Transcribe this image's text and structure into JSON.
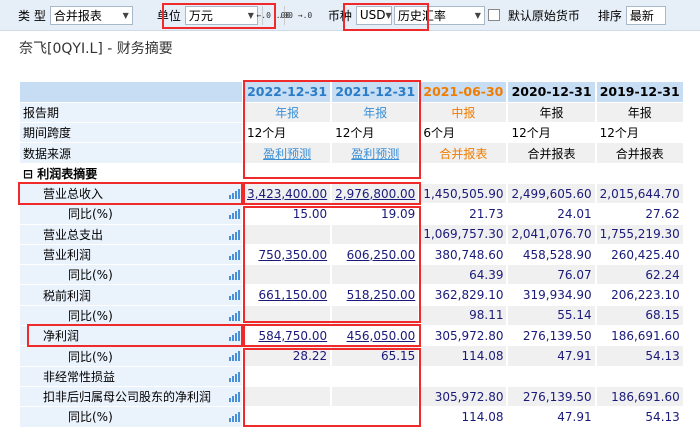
{
  "toolbar": {
    "type_label": "类 型",
    "type_value": "合并报表",
    "unit_label": "单位",
    "unit_value": "万元",
    "currency_label": "币种",
    "currency_value": "USD",
    "rate_value": "历史汇率",
    "default_currency_label": "默认原始货币",
    "sort_label": "排序",
    "sort_value": "最新",
    "dec_icon1": "←.0 .00",
    "dec_icon2": ".00 →.0"
  },
  "title": "奈飞[0QYI.L] - 财务摘要",
  "colors": {
    "header_bg": "#c7ddf4",
    "label_bg": "#eaf2fc",
    "highlight": "#f02a2a",
    "interim": "#f07c00",
    "forecast": "#3a8fd6"
  },
  "columns": [
    {
      "date": "2022-12-31",
      "period": "年报",
      "span": "12个月",
      "source": "盈利预测",
      "style": "forecast"
    },
    {
      "date": "2021-12-31",
      "period": "年报",
      "span": "12个月",
      "source": "盈利预测",
      "style": "forecast"
    },
    {
      "date": "2021-06-30",
      "period": "中报",
      "span": "6个月",
      "source": "合并报表",
      "style": "interim"
    },
    {
      "date": "2020-12-31",
      "period": "年报",
      "span": "12个月",
      "source": "合并报表",
      "style": "normal"
    },
    {
      "date": "2019-12-31",
      "period": "年报",
      "span": "12个月",
      "source": "合并报表",
      "style": "normal"
    }
  ],
  "meta_labels": {
    "period": "报告期",
    "span": "期间跨度",
    "source": "数据来源"
  },
  "section": {
    "toggle": "⊟",
    "label": "利润表摘要"
  },
  "rows": [
    {
      "label": "营业总收入",
      "indent": 1,
      "link": true,
      "values": [
        "3,423,400.00",
        "2,976,800.00",
        "1,450,505.90",
        "2,499,605.60",
        "2,015,644.70"
      ]
    },
    {
      "label": "同比(%)",
      "indent": 2,
      "values": [
        "15.00",
        "19.09",
        "21.73",
        "24.01",
        "27.62"
      ]
    },
    {
      "label": "营业总支出",
      "indent": 1,
      "values": [
        "",
        "",
        "1,069,757.30",
        "2,041,076.70",
        "1,755,219.30"
      ]
    },
    {
      "label": "营业利润",
      "indent": 1,
      "link": true,
      "values": [
        "750,350.00",
        "606,250.00",
        "380,748.60",
        "458,528.90",
        "260,425.40"
      ]
    },
    {
      "label": "同比(%)",
      "indent": 2,
      "values": [
        "",
        "",
        "64.39",
        "76.07",
        "62.24"
      ]
    },
    {
      "label": "税前利润",
      "indent": 1,
      "link": true,
      "values": [
        "661,150.00",
        "518,250.00",
        "362,829.10",
        "319,934.90",
        "206,223.10"
      ]
    },
    {
      "label": "同比(%)",
      "indent": 2,
      "values": [
        "",
        "",
        "98.11",
        "55.14",
        "68.15"
      ]
    },
    {
      "label": "净利润",
      "indent": 1,
      "link": true,
      "values": [
        "584,750.00",
        "456,050.00",
        "305,972.80",
        "276,139.50",
        "186,691.60"
      ]
    },
    {
      "label": "同比(%)",
      "indent": 2,
      "values": [
        "28.22",
        "65.15",
        "114.08",
        "47.91",
        "54.13"
      ]
    },
    {
      "label": "非经常性损益",
      "indent": 1,
      "values": [
        "",
        "",
        "",
        "",
        ""
      ]
    },
    {
      "label": "扣非后归属母公司股东的净利润",
      "indent": 1,
      "values": [
        "",
        "",
        "305,972.80",
        "276,139.50",
        "186,691.60"
      ]
    },
    {
      "label": "同比(%)",
      "indent": 2,
      "values": [
        "",
        "",
        "114.08",
        "47.91",
        "54.13"
      ]
    }
  ]
}
